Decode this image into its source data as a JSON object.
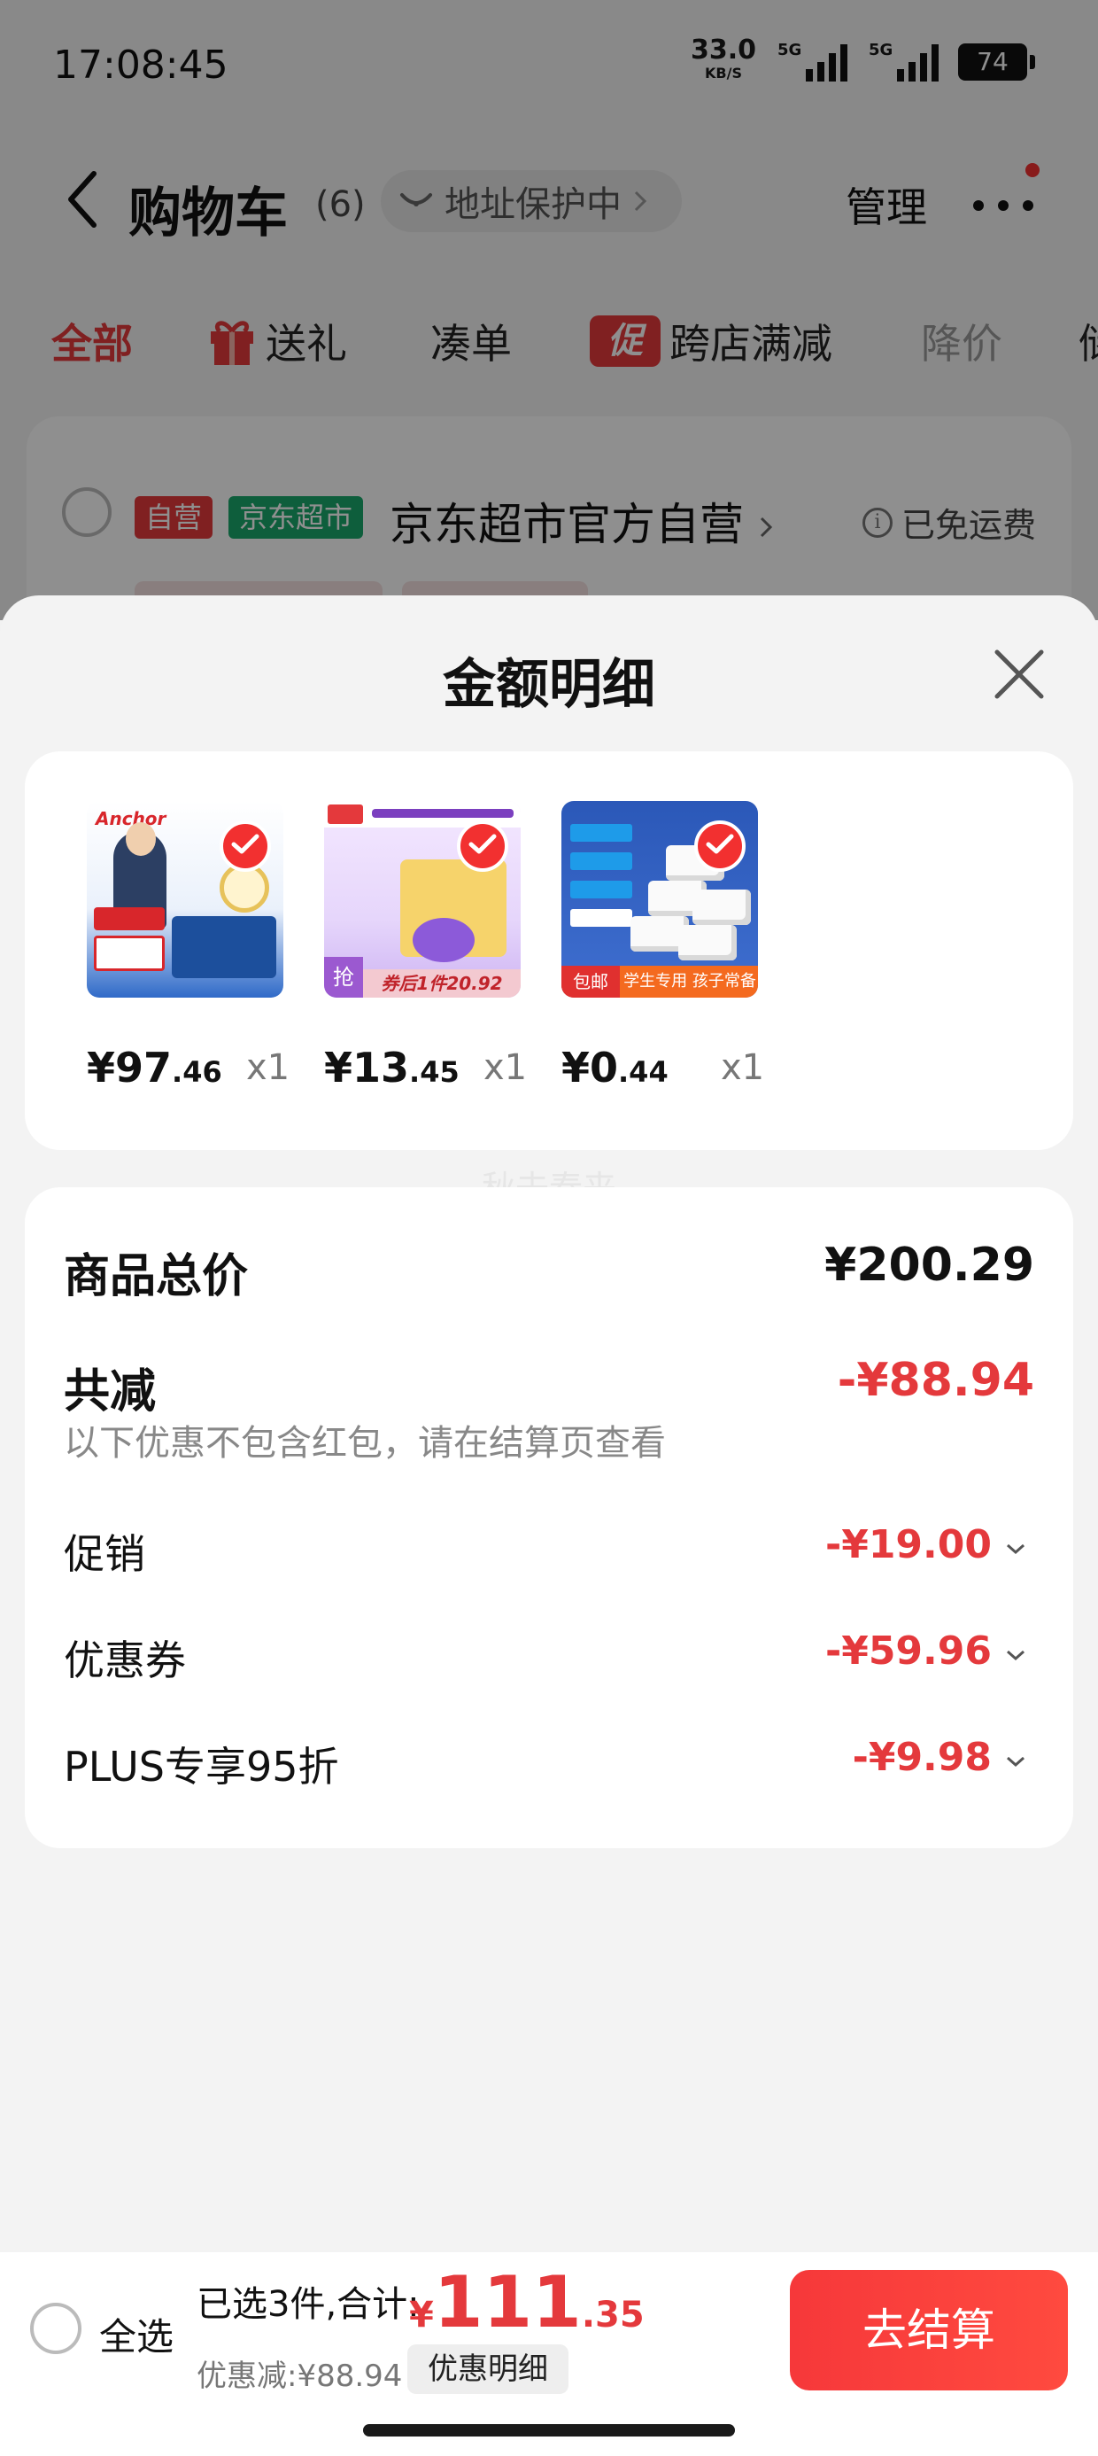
{
  "status_bar": {
    "time": "17:08:45",
    "net_speed": "33.0",
    "net_unit": "KB/S",
    "signal_1": "5G",
    "signal_2": "5G",
    "battery": "74"
  },
  "nav": {
    "title": "购物车",
    "count": "(6)",
    "address": "地址保护中",
    "manage": "管理"
  },
  "tabs": [
    {
      "label": "全部",
      "active": true
    },
    {
      "label": "送礼"
    },
    {
      "label": "凑单"
    },
    {
      "label": "跨店满减",
      "badge": "促"
    },
    {
      "label": "降价"
    },
    {
      "label": "储"
    }
  ],
  "shop": {
    "tag_self": "自营",
    "tag_market": "京东超市",
    "name": "京东超市官方自营",
    "shipping": "已免运费"
  },
  "sheet": {
    "title": "金额明细",
    "products": [
      {
        "price_int": "¥97",
        "price_dec": ".46",
        "qty": "x1"
      },
      {
        "price_int": "¥13",
        "price_dec": ".45",
        "qty": "x1"
      },
      {
        "price_int": "¥0",
        "price_dec": ".44",
        "qty": "x1"
      }
    ],
    "thumb_texts": {
      "p1_logo": "Anchor",
      "p2_grab": "抢",
      "p2_footer": "券后1件20.92",
      "p3_left": "包邮",
      "p3_right": "学生专用 孩子常备"
    },
    "watermark": "秋去春来",
    "summary": {
      "total_label": "商品总价",
      "total_value": "¥200.29",
      "discount_label": "共减",
      "discount_value": "-¥88.94",
      "note": "以下优惠不包含红包，请在结算页查看",
      "rows": [
        {
          "label": "促销",
          "value": "-¥19.00"
        },
        {
          "label": "优惠券",
          "value": "-¥59.96"
        },
        {
          "label": "PLUS专享95折",
          "value": "-¥9.98"
        }
      ]
    }
  },
  "bottom": {
    "select_all": "全选",
    "selected_text": "已选3件,合计:",
    "total_currency": "¥",
    "total_int": "111",
    "total_dec": ".35",
    "discount_text": "优惠减:¥88.94",
    "detail_button": "优惠明细",
    "checkout_button": "去结算"
  },
  "colors": {
    "accent_red": "#e4393c",
    "market_green": "#19a86b"
  }
}
